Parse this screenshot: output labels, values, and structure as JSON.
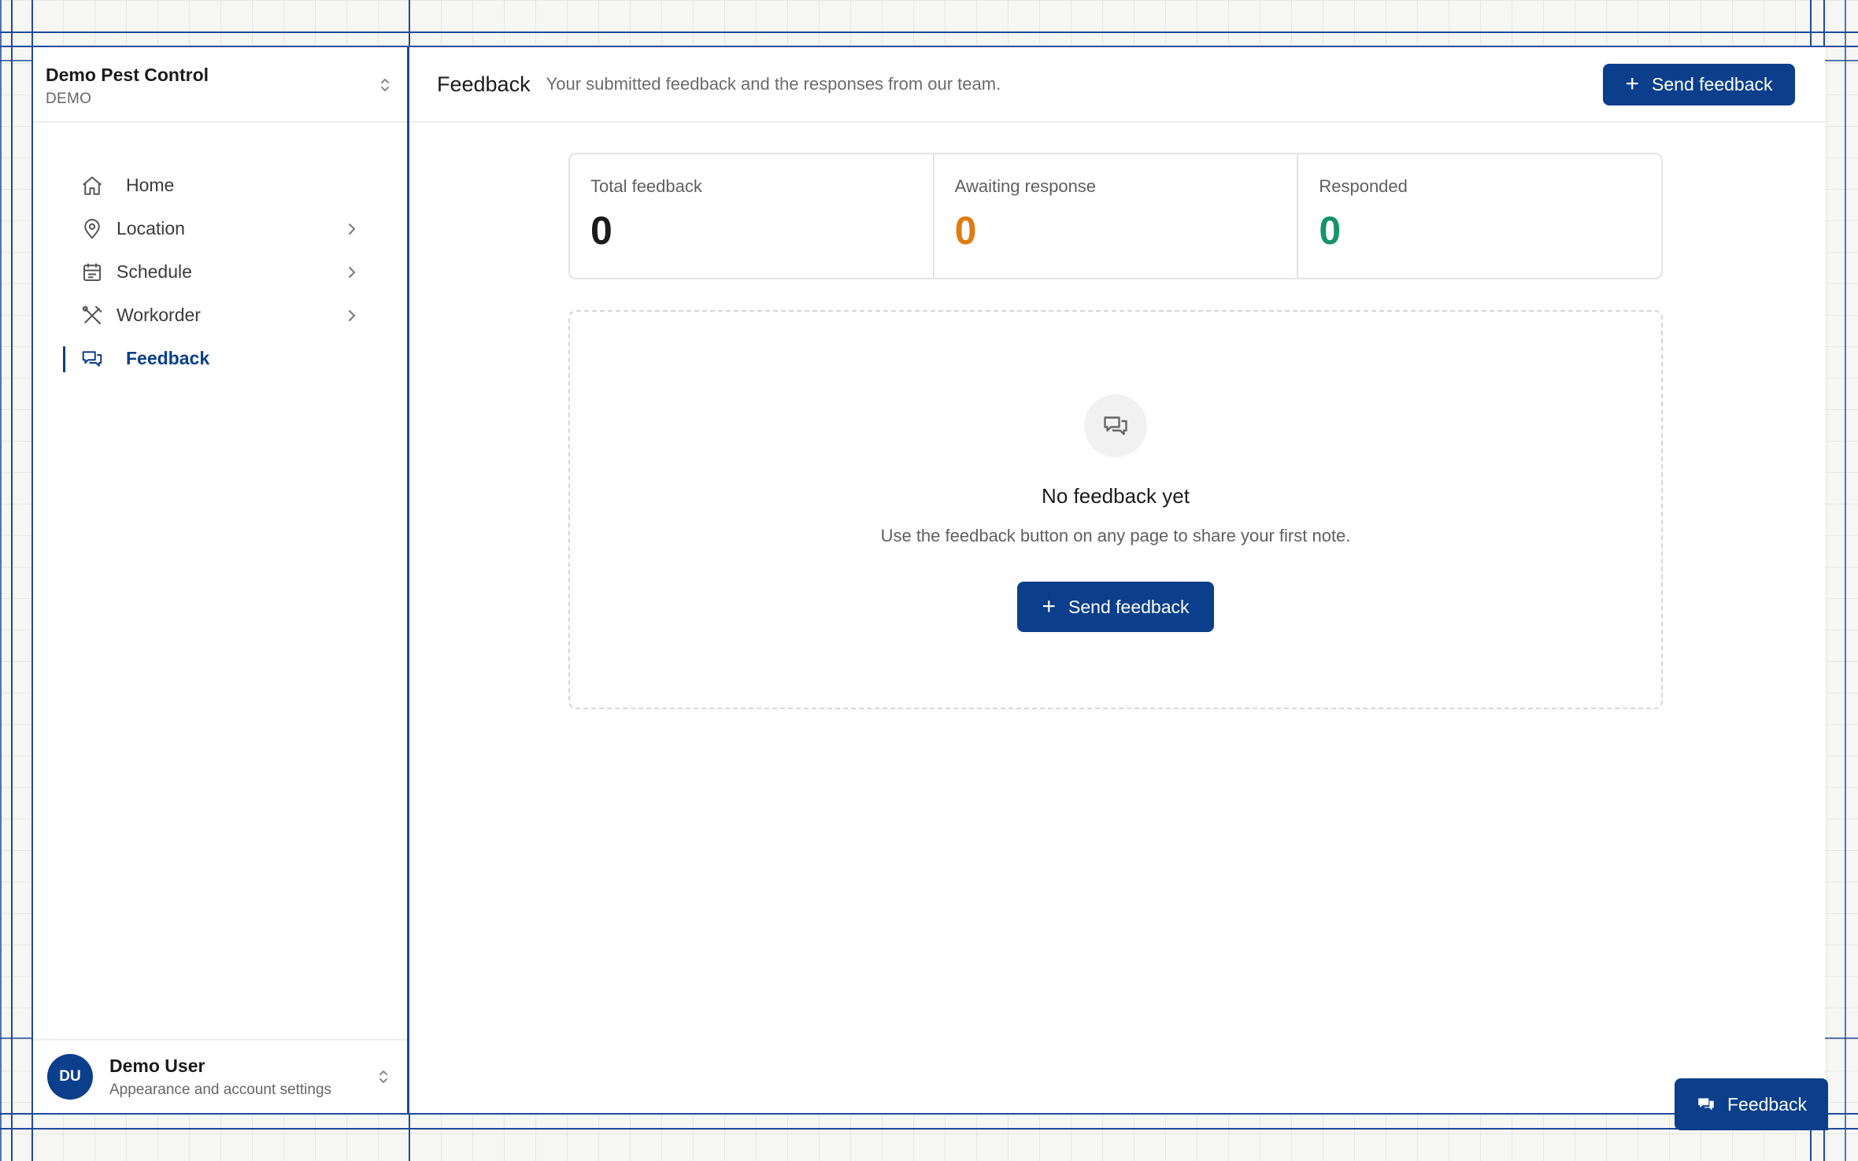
{
  "org": {
    "name": "Demo Pest Control",
    "subtitle": "DEMO"
  },
  "nav": {
    "items": [
      {
        "label": "Home",
        "icon": "home-icon"
      },
      {
        "label": "Location",
        "icon": "map-pin-icon"
      },
      {
        "label": "Schedule",
        "icon": "calendar-icon"
      },
      {
        "label": "Workorder",
        "icon": "tools-icon"
      },
      {
        "label": "Feedback",
        "icon": "chat-bubbles-icon",
        "active": true
      }
    ]
  },
  "user": {
    "initials": "DU",
    "name": "Demo User",
    "subtitle": "Appearance and account settings"
  },
  "header": {
    "title": "Feedback",
    "subtitle": "Your submitted feedback and the responses from our team.",
    "button_label": "Send feedback"
  },
  "stats": [
    {
      "label": "Total feedback",
      "value": "0",
      "color": "#1b1b1b"
    },
    {
      "label": "Awaiting response",
      "value": "0",
      "color": "#e07b12"
    },
    {
      "label": "Responded",
      "value": "0",
      "color": "#179467"
    }
  ],
  "empty_state": {
    "title": "No feedback yet",
    "subtitle": "Use the feedback button on any page to share your first note.",
    "button_label": "Send feedback"
  },
  "floating_button": {
    "label": "Feedback"
  },
  "colors": {
    "accent": "#0b3f8c",
    "guide": "#1e4a9a"
  }
}
